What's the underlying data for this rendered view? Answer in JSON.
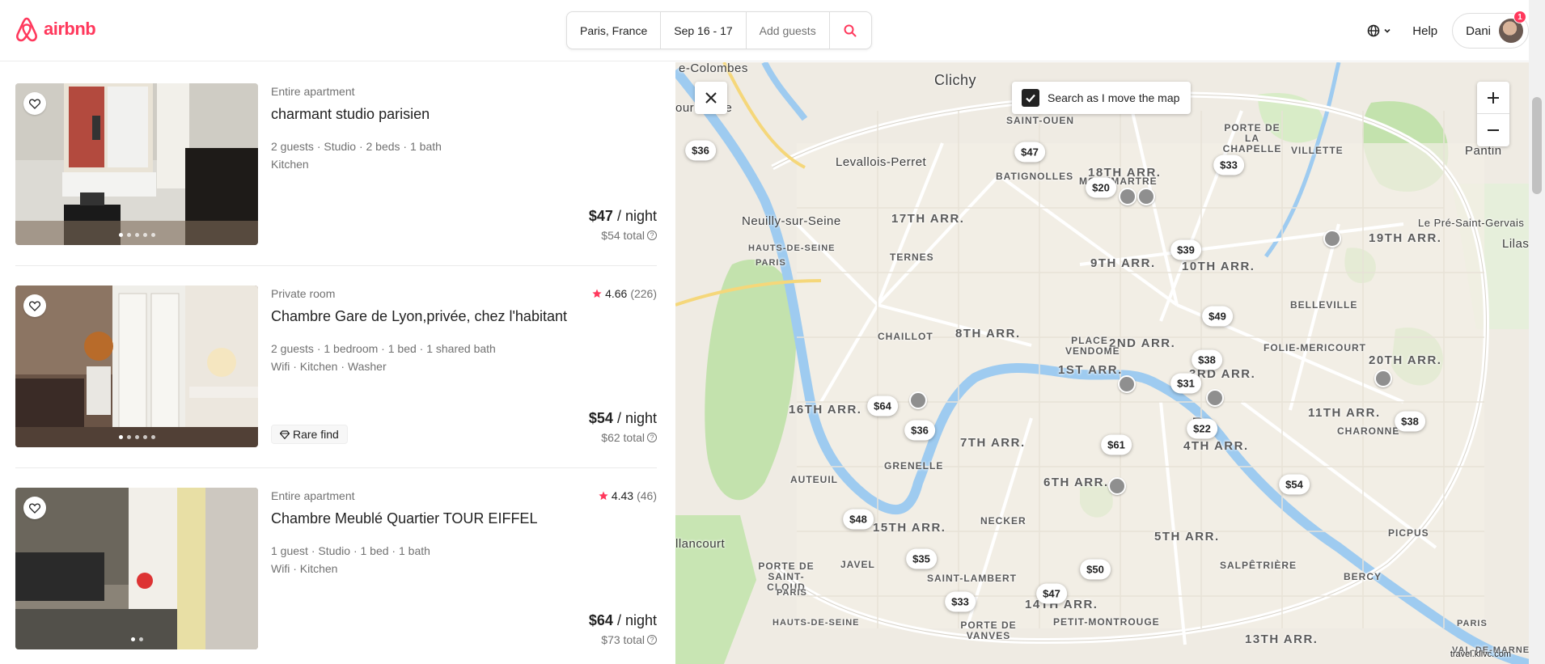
{
  "header": {
    "logo_text": "airbnb",
    "search": {
      "location": "Paris, France",
      "dates": "Sep 16 - 17",
      "guests_placeholder": "Add guests"
    },
    "help_label": "Help",
    "user_name": "Dani",
    "notification_count": "1"
  },
  "listings": [
    {
      "type": "Entire apartment",
      "title": "charmant studio parisien",
      "details_line1": "2 guests · Studio · 2 beds · 1 bath",
      "details_line2": "Kitchen",
      "rating": "",
      "rating_count": "",
      "price": "$47",
      "price_unit": " / night",
      "total": "$54 total",
      "badge": "",
      "photo_count": 5,
      "active_photo": 0
    },
    {
      "type": "Private room",
      "title": "Chambre Gare de Lyon,privée, chez l'habitant",
      "details_line1": "2 guests · 1 bedroom · 1 bed · 1 shared bath",
      "details_line2": "Wifi · Kitchen · Washer",
      "rating": "4.66",
      "rating_count": "(226)",
      "price": "$54",
      "price_unit": " / night",
      "total": "$62 total",
      "badge": "Rare find",
      "photo_count": 5,
      "active_photo": 0
    },
    {
      "type": "Entire apartment",
      "title": "Chambre Meublé Quartier TOUR EIFFEL",
      "details_line1": "1 guest · Studio · 1 bed · 1 bath",
      "details_line2": "Wifi · Kitchen",
      "rating": "4.43",
      "rating_count": "(46)",
      "price": "$64",
      "price_unit": " / night",
      "total": "$73 total",
      "badge": "",
      "photo_count": 2,
      "active_photo": 0
    }
  ],
  "map": {
    "search_toggle_label": "Search as I move the map",
    "search_toggle_checked": true,
    "watermark": "travel.kllvc.com",
    "price_pins": [
      "$36",
      "$47",
      "$33",
      "$20",
      "$39",
      "$49",
      "$38",
      "$31",
      "$64",
      "$36",
      "$22",
      "$61",
      "$38",
      "$54",
      "$48",
      "$35",
      "$50",
      "$33",
      "$47"
    ],
    "labels": {
      "colombes": "e-Colombes",
      "clichy": "Clichy",
      "courbevoie": "ourbevoie",
      "levallois": "Levallois-Perret",
      "neuilly": "Neuilly-sur-Seine",
      "pantin": "Pantin",
      "pre_st_gervais": "Le Pré-Saint-Gervais",
      "lilas": "Lilas",
      "arr17": "17TH ARR.",
      "arr18": "18TH ARR.",
      "arr9": "9TH ARR.",
      "arr10": "10TH ARR.",
      "arr19": "19TH ARR.",
      "arr8": "8TH ARR.",
      "arr2": "2ND ARR.",
      "arr1": "1ST ARR.",
      "arr3": "3RD ARR.",
      "arr20": "20TH ARR.",
      "arr16": "16TH ARR.",
      "arr7": "7TH ARR.",
      "arr4": "4TH ARR.",
      "arr11": "11TH ARR.",
      "arr6": "6TH ARR.",
      "arr15": "15TH ARR.",
      "arr5": "5TH ARR.",
      "arr14": "14TH ARR.",
      "arr13": "13TH ARR.",
      "arr12": "12TH ARR.",
      "batignolles": "BATIGNOLLES",
      "montmartre": "MONTMARTRE",
      "villette": "VILLETTE",
      "ternes": "TERNES",
      "chaillot": "CHAILLOT",
      "place_vendome": "PLACE VENDOME",
      "folie_mericourt": "FOLIE-MERICOURT",
      "belleville": "BELLEVILLE",
      "charonne": "CHARONNE",
      "grenelle": "GRENELLE",
      "auteuil": "AUTEUIL",
      "necker": "NECKER",
      "javel": "JAVEL",
      "saint_lambert": "SAINT-LAMBERT",
      "salpetriere": "SALPÊTRIÈRE",
      "picpus": "PICPUS",
      "bercy": "BERCY",
      "petit_montrouge": "PETIT-MONTROUGE",
      "porte_de_vanves": "PORTE DE VANVES",
      "porte_de_st_cloud": "PORTE DE SAINT-CLOUD",
      "porte_de_st_ouen": "PORTE DE SAINT-OUEN",
      "porte_de_la_chapelle": "PORTE DE LA CHAPELLE",
      "hauts_de_seine": "HAUTS-DE-SEINE",
      "hauts_de_seine2": "HAUTS-DE-SEINE",
      "paris_w": "PARIS",
      "paris_sw": "PARIS",
      "paris_se": "PARIS",
      "val_de_marne": "VAL-DE-MARNE",
      "issy": "llancourt",
      "paris_center": "Pa"
    }
  },
  "colors": {
    "brand": "#ff385c",
    "star": "#ff385c",
    "water": "#9ecbf0",
    "park": "#bfe3a7"
  }
}
